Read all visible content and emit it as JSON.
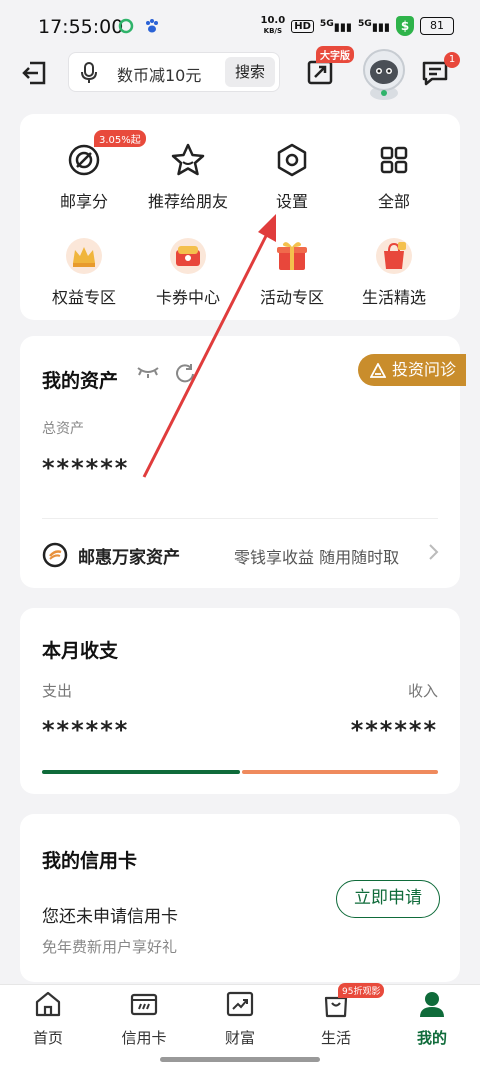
{
  "status_bar": {
    "time": "17:55:00",
    "net_speed_top": "10.0",
    "net_speed_unit": "KB/S",
    "hd": "HD",
    "signal_1": "5G",
    "signal_2": "5G",
    "battery": "81"
  },
  "header": {
    "search_placeholder": "数币减10元",
    "search_button": "搜索",
    "big_font_badge": "大字版",
    "message_count": "1"
  },
  "quick_menu": {
    "items": [
      {
        "label": "邮享分",
        "icon": "points-icon",
        "badge": "3.05%起"
      },
      {
        "label": "推荐给朋友",
        "icon": "star-icon"
      },
      {
        "label": "设置",
        "icon": "settings-icon"
      },
      {
        "label": "全部",
        "icon": "grid-icon"
      },
      {
        "label": "权益专区",
        "icon": "crown-icon"
      },
      {
        "label": "卡券中心",
        "icon": "coupon-icon"
      },
      {
        "label": "活动专区",
        "icon": "gift-icon"
      },
      {
        "label": "生活精选",
        "icon": "shopping-icon"
      }
    ]
  },
  "assets": {
    "title": "我的资产",
    "diagnose_label": "投资问诊",
    "total_label": "总资产",
    "total_value": "******",
    "youhui_title": "邮惠万家资产",
    "youhui_desc": "零钱享收益 随用随时取"
  },
  "monthly": {
    "title": "本月收支",
    "expense_label": "支出",
    "income_label": "收入",
    "expense_value": "******",
    "income_value": "******",
    "expense_ratio": 0.5
  },
  "credit_card": {
    "title": "我的信用卡",
    "text": "您还未申请信用卡",
    "subtext": "免年费新用户享好礼",
    "apply_button": "立即申请"
  },
  "bottom_nav": {
    "items": [
      {
        "label": "首页",
        "icon": "home-icon"
      },
      {
        "label": "信用卡",
        "icon": "credit-card-icon"
      },
      {
        "label": "财富",
        "icon": "wealth-chart-icon"
      },
      {
        "label": "生活",
        "icon": "shopping-bag-icon",
        "badge": "95折观影"
      },
      {
        "label": "我的",
        "icon": "user-icon",
        "active": true
      }
    ]
  },
  "colors": {
    "brand_green": "#0f6b3a",
    "badge_red": "#e84a3c",
    "income_orange": "#ef8a5d",
    "diagnose_gold": "#c98d2c"
  }
}
